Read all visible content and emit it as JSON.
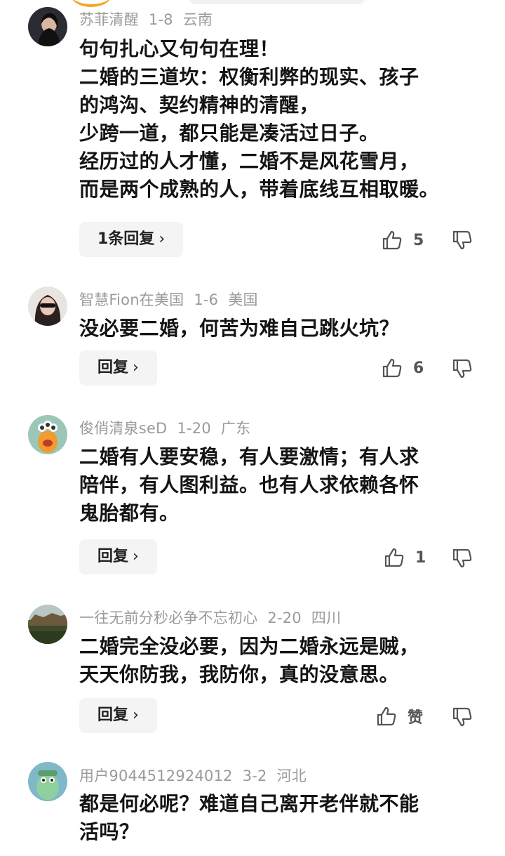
{
  "comments": [
    {
      "username": "苏菲清醒",
      "date": "1-8",
      "location": "云南",
      "lines": [
        "句句扎心又句句在理！",
        "二婚的三道坎：权衡利弊的现实、孩子",
        "的鸿沟、契约精神的清醒，",
        "少跨一道，都只能是凑活过日子。",
        "经历过的人才懂，二婚不是风花雪月，",
        "而是两个成熟的人，带着底线互相取暖。"
      ],
      "reply_label": "1条回复",
      "likes": "5"
    },
    {
      "username": "智慧Fion在美国",
      "date": "1-6",
      "location": "美国",
      "lines": [
        "没必要二婚，何苦为难自己跳火坑？"
      ],
      "reply_label": "回复",
      "likes": "6"
    },
    {
      "username": "俊俏清泉seD",
      "date": "1-20",
      "location": "广东",
      "lines": [
        "二婚有人要安稳，有人要激情；有人求",
        "陪伴，有人图利益。也有人求依赖各怀",
        "鬼胎都有。"
      ],
      "reply_label": "回复",
      "likes": "1"
    },
    {
      "username": "一往无前分秒必争不忘初心",
      "date": "2-20",
      "location": "四川",
      "lines": [
        "二婚完全没必要，因为二婚永远是贼，",
        "天天你防我，我防你，真的没意思。"
      ],
      "reply_label": "回复",
      "likes": "赞"
    },
    {
      "username": "用户9044512924012",
      "date": "3-2",
      "location": "河北",
      "lines": [
        "都是何必呢？难道自己离开老伴就不能",
        "活吗？"
      ],
      "reply_label": "",
      "likes": ""
    }
  ],
  "icons": {
    "like": "thumbs-up-icon",
    "dislike": "thumbs-down-icon",
    "chevron": "chevron-right-icon"
  },
  "colors": {
    "meta_text": "#9a9a9a",
    "body_text": "#141414",
    "button_bg": "#f4f4f4"
  }
}
